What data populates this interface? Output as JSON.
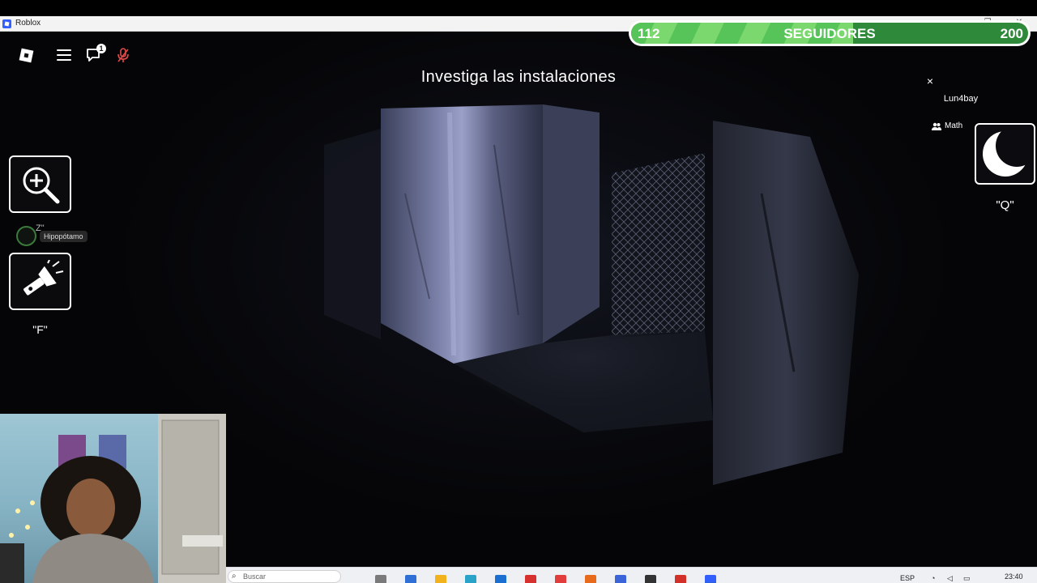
{
  "window": {
    "title": "Roblox",
    "controls": [
      "—",
      "❐",
      "✕"
    ]
  },
  "followers": {
    "current": "112",
    "label": "SEGUIDORES",
    "goal": "200",
    "progress": 0.56
  },
  "hud": {
    "objective": "Investiga las instalaciones",
    "chat_badge": "1",
    "player_list": {
      "close": "×",
      "player": "Lun4bay",
      "team": "Math"
    },
    "moon_key": "\"Q\"",
    "flashlight_key": "\"F\"",
    "teammate": {
      "name": "Hipopótamo",
      "key": "Z\""
    }
  },
  "taskbar": {
    "search_placeholder": "Buscar",
    "language": "ESP",
    "time": "23:40",
    "app_colors": [
      "#7a7a7a",
      "#2f6fd6",
      "#f2b21b",
      "#2aa3c9",
      "#1b6fd1",
      "#d6302f",
      "#e23d3d",
      "#e86a1d",
      "#3b64d8",
      "#333333",
      "#d4302a",
      "#335fff"
    ]
  }
}
